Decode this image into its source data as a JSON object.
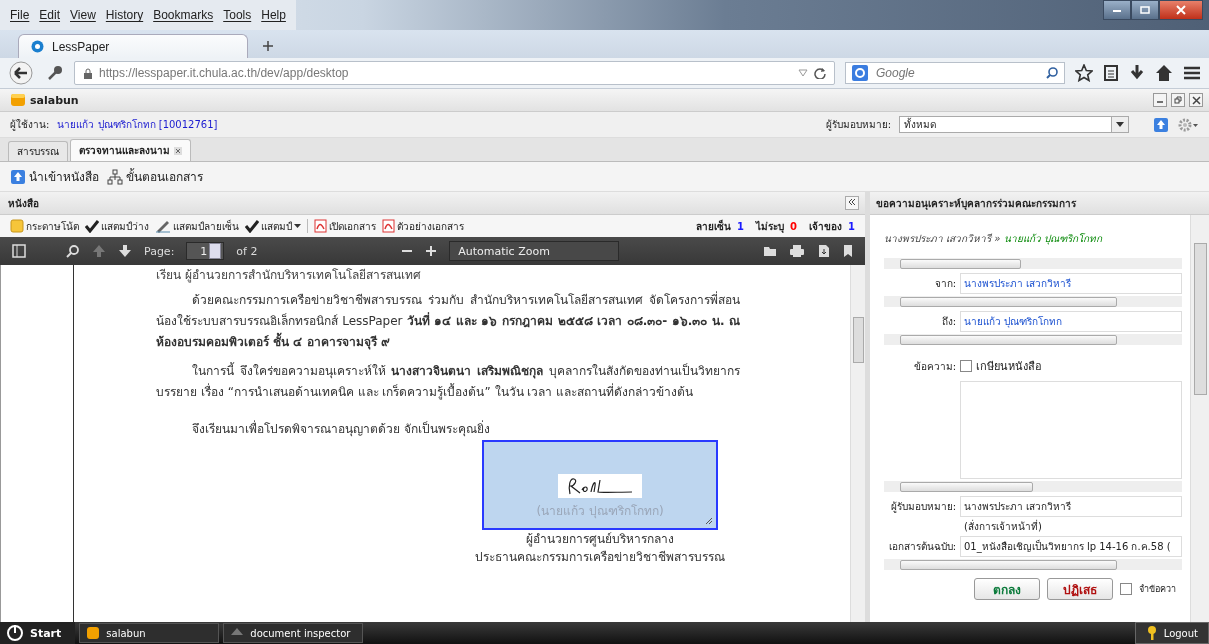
{
  "browser": {
    "menu": [
      "File",
      "Edit",
      "View",
      "History",
      "Bookmarks",
      "Tools",
      "Help"
    ],
    "tab": {
      "title": "LessPaper"
    },
    "url_host": "https://lesspaper.it.chula.ac.th",
    "url_path": "/dev/app/desktop",
    "search_placeholder": "Google"
  },
  "app": {
    "title": "salabun",
    "user_label": "ผู้ใช้งาน:",
    "user": "นายแก้ว ปุณฑริกโกทก [10012761]",
    "assignee_label": "ผู้รับมอบหมาย:",
    "assignee": "ทั้งหมด"
  },
  "tabs": [
    {
      "label": "สารบรรณ",
      "selected": false,
      "closable": false
    },
    {
      "label": "ตรวจทานและลงนาม",
      "selected": true,
      "closable": true
    }
  ],
  "actions": [
    {
      "label": "นำเข้าหนังสือ",
      "kind": "import"
    },
    {
      "label": "ขั้นตอนเอกสาร",
      "kind": "flow"
    }
  ],
  "doc_panel": {
    "title": "หนังสือ",
    "tools": [
      {
        "label": "กระดาษโน้ต",
        "kind": "note"
      },
      {
        "label": "แสตมป์ว่าง",
        "kind": "stamp"
      },
      {
        "label": "แสตมป์ลายเซ็น",
        "kind": "sign"
      },
      {
        "label": "แสตมป์",
        "kind": "stamp-menu"
      },
      {
        "label": "เปิดเอกสาร",
        "kind": "pdf"
      },
      {
        "label": "ตัวอย่างเอกสาร",
        "kind": "pdf"
      }
    ],
    "counts": [
      {
        "label": "ลายเซ็น",
        "value": "1",
        "color": "#1a1aff"
      },
      {
        "label": "ไม่ระบุ",
        "value": "0",
        "color": "#ff0000"
      },
      {
        "label": "เจ้าของ",
        "value": "1",
        "color": "#1a1aff"
      }
    ]
  },
  "pdf": {
    "page_label": "Page:",
    "page": "1",
    "page_count": "of 2",
    "zoom": "Automatic Zoom"
  },
  "document": {
    "salutation": "เรียน   ผู้อำนวยการสำนักบริหารเทคโนโลยีสารสนเทศ",
    "paragraphs": [
      "ด้วยคณะกรรมการเครือข่ายวิชาชีพสารบรรณ ร่วมกับ สำนักบริหารเทคโนโลยีสารสนเทศ จัดโครงการพี่สอนน้องใช้ระบบสารบรรณอิเล็กทรอนิกส์ LessPaper **วันที่ ๑๔ และ ๑๖ กรกฎาคม ๒๕๕๘  เวลา ๐๘.๓๐- ๑๖.๓๐ น. ณ ห้องอบรมคอมพิวเตอร์ ชั้น ๔ อาคารจามจุรี ๙**",
      "ในการนี้ จึงใคร่ขอความอนุเคราะห์ให้ **นางสาวจินตนา  เสริมพณิชกุล** บุคลากรในสังกัดของท่านเป็นวิทยากร บรรยาย เรื่อง “การนำเสนอด้านเทคนิค และ เกร็ดความรู้เบื้องต้น” ในวัน เวลา และสถานที่ดังกล่าวข้างต้น",
      "จึงเรียนมาเพื่อโปรดพิจารณาอนุญาตด้วย จักเป็นพระคุณยิ่ง"
    ],
    "signer": "(นายแก้ว  ปุณฑริกโกทก)",
    "positions": [
      "ผู้อำนวยการศูนย์บริหารกลาง",
      "ประธานคณะกรรมการเครือข่ายวิชาชีพสารบรรณ"
    ]
  },
  "side_panel": {
    "title": "ขอความอนุเคราะห์บุคลากรร่วมคณะกรรมการ",
    "route_from": "นางพรประภา เสวกวิหารี »",
    "route_to": "นายแก้ว ปุณฑริกโกทก",
    "from_label": "จาก:",
    "from": "นางพรประภา เสวกวิหารี",
    "to_label": "ถึง:",
    "to": "นายแก้ว ปุณฑริกโกทก",
    "message_label": "ข้อความ:",
    "endorse": {
      "label": "เกษียนหนังสือ",
      "checked": false
    },
    "assignee_label": "ผู้รับมอบหมาย:",
    "assignee": "นางพรประภา เสวกวิหารี",
    "assignee_note": "(สั่งการเจ้าหน้าที่)",
    "original_label": "เอกสารต้นฉบับ:",
    "original": "01_หนังสือเชิญเป็นวิทยากร  lp 14-16 ก.ค.58 (",
    "ok": "ตกลง",
    "reject": "ปฏิเสธ",
    "remember": {
      "label": "จำข้อควา",
      "checked": false
    }
  },
  "taskbar": {
    "start": "Start",
    "items": [
      {
        "label": "salabun",
        "kind": "app"
      },
      {
        "label": "document inspector",
        "kind": "inspector"
      }
    ],
    "logout": "Logout"
  }
}
